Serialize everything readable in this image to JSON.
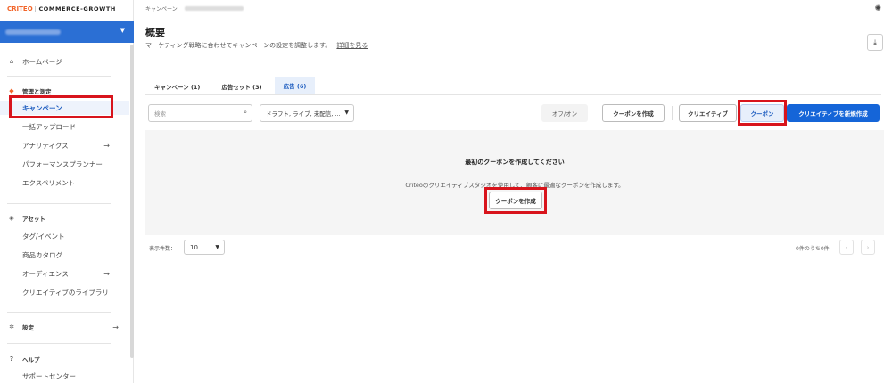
{
  "brand": {
    "logo": "CRITEO",
    "separator": "|",
    "product": "COMMERCE-GROWTH"
  },
  "sidebar": {
    "home": "ホームページ",
    "groups": {
      "manage": "管理と測定",
      "assets": "アセット",
      "settings": "設定",
      "help": "ヘルプ"
    },
    "manage_items": [
      "キャンペーン",
      "一括アップロード",
      "アナリティクス",
      "パフォーマンスプランナー",
      "エクスペリメント"
    ],
    "asset_items": [
      "タグ/イベント",
      "商品カタログ",
      "オーディエンス",
      "クリエイティブのライブラリ"
    ],
    "help_items": [
      "サポートセンター"
    ],
    "arrow": "→"
  },
  "header": {
    "breadcrumb": "キャンペーン",
    "title": "概要",
    "description": "マーケティング戦略に合わせてキャンペーンの設定を調整します。",
    "details_link": "詳細を見る"
  },
  "tabs": [
    "キャンペーン (1)",
    "広告セット (3)",
    "広告 (6)"
  ],
  "toolbar": {
    "search_placeholder": "検索",
    "filter_value": "ドラフト, ライブ, 未配信, ...",
    "off_on": "オフ/オン",
    "create_coupon": "クーポンを作成",
    "creative": "クリエイティブ",
    "coupon": "クーポン",
    "new_creative": "クリエイティブを新規作成"
  },
  "empty_state": {
    "title": "最初のクーポンを作成してください",
    "description": "Criteoのクリエイティブスタジオを使用して、顧客に最適なクーポンを作成します。",
    "button": "クーポンを作成"
  },
  "pagination": {
    "label": "表示件数：",
    "page_size": "10",
    "count": "0件のうち0件",
    "prev": "‹",
    "next": "›"
  },
  "colors": {
    "accent": "#1565d8",
    "highlight": "#d8141c",
    "brand_orange": "#f2652a"
  }
}
